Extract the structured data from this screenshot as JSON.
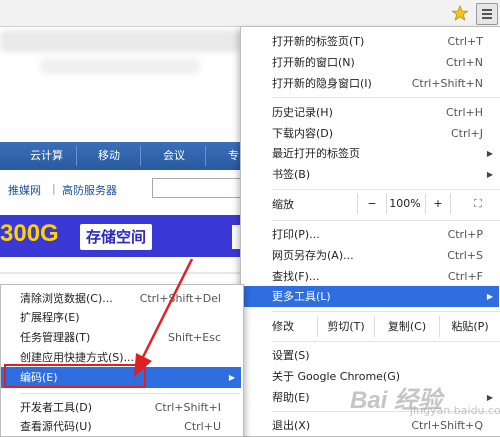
{
  "page": {
    "nav_items": [
      "云计算",
      "移动",
      "会议",
      "专"
    ],
    "sub_links": [
      "推媒网",
      "高防服务器"
    ],
    "banner_big": "300G",
    "banner_tag": "存储空间"
  },
  "main_menu": {
    "group1": [
      {
        "label": "打开新的标签页(T)",
        "shortcut": "Ctrl+T"
      },
      {
        "label": "打开新的窗口(N)",
        "shortcut": "Ctrl+N"
      },
      {
        "label": "打开新的隐身窗口(I)",
        "shortcut": "Ctrl+Shift+N"
      }
    ],
    "group2": [
      {
        "label": "历史记录(H)",
        "shortcut": "Ctrl+H"
      },
      {
        "label": "下载内容(D)",
        "shortcut": "Ctrl+J"
      },
      {
        "label": "最近打开的标签页",
        "shortcut": ""
      },
      {
        "label": "书签(B)",
        "shortcut": ""
      }
    ],
    "zoom": {
      "label": "缩放",
      "minus": "−",
      "value": "100%",
      "plus": "+",
      "fullscreen": "⛶"
    },
    "group3": [
      {
        "label": "打印(P)...",
        "shortcut": "Ctrl+P"
      },
      {
        "label": "网页另存为(A)...",
        "shortcut": "Ctrl+S"
      },
      {
        "label": "查找(F)...",
        "shortcut": "Ctrl+F"
      },
      {
        "label": "更多工具(L)",
        "shortcut": ""
      }
    ],
    "edit": {
      "label": "修改",
      "cut": "剪切(T)",
      "copy": "复制(C)",
      "paste": "粘贴(P)"
    },
    "group4": [
      {
        "label": "设置(S)"
      },
      {
        "label": "关于 Google Chrome(G)"
      },
      {
        "label": "帮助(E)"
      }
    ],
    "exit": {
      "label": "退出(X)",
      "shortcut": "Ctrl+Shift+Q"
    }
  },
  "sub_menu": {
    "group1": [
      {
        "label": "清除浏览数据(C)...",
        "shortcut": "Ctrl+Shift+Del"
      },
      {
        "label": "扩展程序(E)",
        "shortcut": ""
      },
      {
        "label": "任务管理器(T)",
        "shortcut": "Shift+Esc"
      },
      {
        "label": "创建应用快捷方式(S)...",
        "shortcut": ""
      },
      {
        "label": "编码(E)",
        "shortcut": ""
      }
    ],
    "group2": [
      {
        "label": "开发者工具(D)",
        "shortcut": "Ctrl+Shift+I"
      },
      {
        "label": "查看源代码(U)",
        "shortcut": "Ctrl+U"
      }
    ]
  },
  "watermark": {
    "text": "Bai 经验",
    "sub": "jingyan.baidu.com"
  },
  "colors": {
    "highlight": "#2f6ee0",
    "arrow": "#e02020",
    "nav": "#2f62ad",
    "banner": "#3a39d6",
    "banner_text": "#ffd200"
  }
}
